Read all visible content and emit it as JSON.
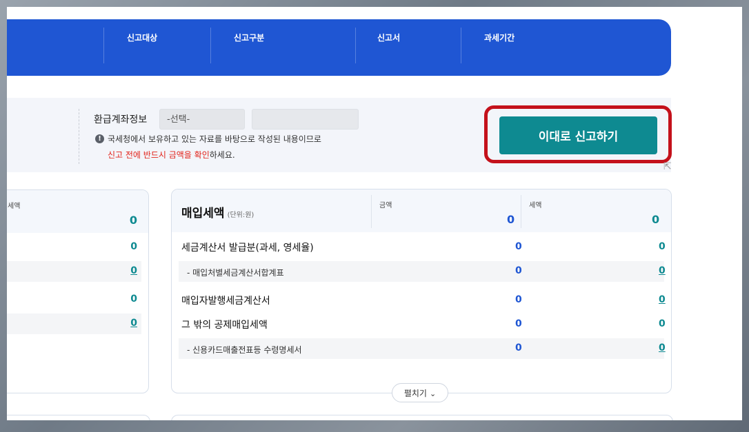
{
  "header": {
    "columns": [
      "신고대상",
      "신고구분",
      "신고서",
      "과세기간"
    ]
  },
  "refund": {
    "label": "환급계좌정보",
    "select_value": "-선택-"
  },
  "notice": {
    "line1": "국세청에서 보유하고 있는 자료를 바탕으로 작성된 내용이므로",
    "line2_red": "신고 전에 반드시 금액을 확인",
    "line2_rest": "하세요."
  },
  "submit_label": "이대로 신고하기",
  "left_panel": {
    "head_label": "세액",
    "head_value": "0",
    "rows": [
      "0",
      "0",
      "0",
      "0"
    ]
  },
  "purchase_panel": {
    "title": "매입세액",
    "unit": "(단위:원)",
    "amount_label": "금액",
    "tax_label": "세액",
    "amount_total": "0",
    "tax_total": "0",
    "rows": [
      {
        "label": "세금계산서 발급분(과세, 영세율)",
        "amount": "0",
        "tax": "0"
      },
      {
        "label": "- 매입처별세금계산서합계표",
        "amount": "0",
        "tax": "0"
      },
      {
        "label": "매입자발행세금계산서",
        "amount": "0",
        "tax": "0"
      },
      {
        "label": "그 밖의 공제매입세액",
        "amount": "0",
        "tax": "0"
      },
      {
        "label": "- 신용카드매출전표등 수령명세서",
        "amount": "0",
        "tax": "0"
      }
    ]
  },
  "expand_label": "펼치기",
  "colors": {
    "header_blue": "#1f56d3",
    "button_teal": "#0e8a91",
    "highlight_red": "#c4111b",
    "notice_red": "#e2231a"
  }
}
